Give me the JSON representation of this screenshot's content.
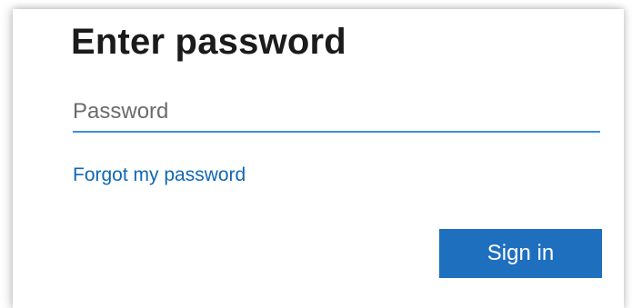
{
  "signin": {
    "title": "Enter password",
    "password": {
      "value": "",
      "placeholder": "Password"
    },
    "forgot_link": "Forgot my password",
    "submit_label": "Sign in"
  },
  "colors": {
    "accent": "#1f6fbf",
    "link": "#0f67b4",
    "input_underline": "#3f8ed3",
    "title_text": "#1b1b1b"
  }
}
